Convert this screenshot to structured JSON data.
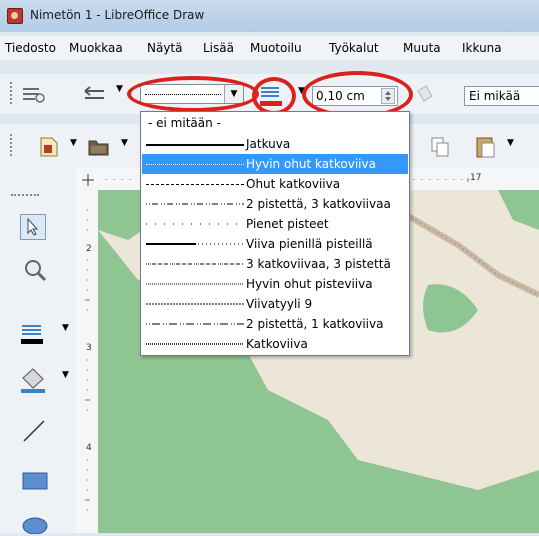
{
  "window": {
    "title": "Nimetön 1 - LibreOffice Draw"
  },
  "menu": [
    "Tiedosto",
    "Muokkaa",
    "Näytä",
    "Lisää",
    "Muotoilu",
    "Työkalut",
    "Muuta",
    "Ikkuna"
  ],
  "toolbar": {
    "line_width": "0,10 cm",
    "area_style": "Ei mikää"
  },
  "ruler": {
    "top_label": "17",
    "left_labels": [
      "2",
      "3",
      "4"
    ]
  },
  "line_style_dropdown": {
    "items": [
      "- ei mitään -",
      "Jatkuva",
      "Hyvin ohut katkoviiva",
      "Ohut katkoviiva",
      "2 pistettä, 3 katkoviivaa",
      "Pienet pisteet",
      "Viiva pienillä pisteillä",
      "3 katkoviivaa, 3 pistettä",
      "Hyvin ohut pisteviiva",
      "Viivatyyli 9",
      "2 pistettä, 1 katkoviiva",
      "Katkoviiva"
    ],
    "selected_index": 2
  },
  "colors": {
    "highlight": "#3399ff",
    "annotation_red": "#d8231d",
    "map_green": "#8fc592",
    "map_land": "#ece6d8"
  }
}
